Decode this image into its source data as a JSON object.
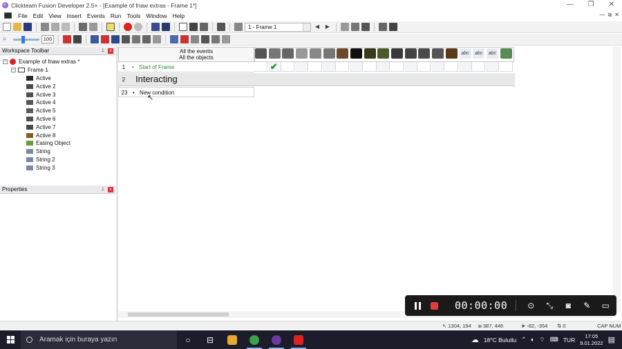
{
  "window": {
    "title": "Clickteam Fusion Developer 2.5+ - [Example of fnaw extras - Frame 1*]",
    "controls": [
      "—",
      "❐",
      "✕"
    ]
  },
  "menu": {
    "items": [
      "File",
      "Edit",
      "View",
      "Insert",
      "Events",
      "Run",
      "Tools",
      "Window",
      "Help"
    ],
    "mdi_controls": [
      "—",
      "⧉",
      "✕"
    ]
  },
  "toolbar": {
    "frame_selector": "1 - Frame 1",
    "zoom_value": "100"
  },
  "workspace": {
    "title": "Workspace Toolbar",
    "application": "Example of fnaw extras *",
    "frame": "Frame 1",
    "objects": [
      {
        "name": "Active",
        "icon_color": "#2a2a2a"
      },
      {
        "name": "Active 2",
        "icon_color": "#4a4a4a"
      },
      {
        "name": "Active 3",
        "icon_color": "#4f4f4f"
      },
      {
        "name": "Active 4",
        "icon_color": "#555555"
      },
      {
        "name": "Active 5",
        "icon_color": "#5a5a5a"
      },
      {
        "name": "Active 6",
        "icon_color": "#505050"
      },
      {
        "name": "Active 7",
        "icon_color": "#4a4a4a"
      },
      {
        "name": "Active 8",
        "icon_color": "#8a5a2a"
      },
      {
        "name": "Easing Object",
        "icon_color": "#6a9a3a"
      },
      {
        "name": "String",
        "icon_color": "#7a8aa0"
      },
      {
        "name": "String 2",
        "icon_color": "#7a8aa0"
      },
      {
        "name": "String 3",
        "icon_color": "#7a8aa0"
      }
    ]
  },
  "properties": {
    "title": "Properties"
  },
  "events": {
    "header_line1": "All the events",
    "header_line2": "All the objects",
    "rows": [
      {
        "num": "1",
        "bullet": "•",
        "condition": "Start of Frame",
        "color": "#2a8a2a"
      },
      {
        "num": "2",
        "comment": "Interacting"
      },
      {
        "num": "23",
        "bullet": "•",
        "condition": "New condition",
        "color": "#111111"
      }
    ],
    "check_mark": "✔",
    "object_icon_colors": [
      "#555",
      "#777",
      "#666",
      "#999",
      "#888",
      "#777",
      "#6a4a2a",
      "#111",
      "#3a3a1a",
      "#4a5a2a",
      "#3a3a3a",
      "#444",
      "#4a4a4a",
      "#555",
      "#5a3a1a",
      "#8a9ab0",
      "#8a9ab0",
      "#8a9ab0",
      "#5a8a5a"
    ],
    "text_icon_label": "abc"
  },
  "statusbar": {
    "mouse_pos": "1304, 194",
    "frame_size": "387, 446",
    "cursor_pos": "-82, -354",
    "zoom": "0",
    "indicators": "CAP NUM"
  },
  "recorder": {
    "time": "00:00:00"
  },
  "taskbar": {
    "search_placeholder": "Aramak için buraya yazın",
    "weather": "18°C  Bulutlu",
    "language": "TUR",
    "time": "17:05",
    "date": "9.01.2022",
    "app_colors": [
      "#e8a735",
      "#3aa34a",
      "#6a3aa0",
      "#d22"
    ]
  }
}
